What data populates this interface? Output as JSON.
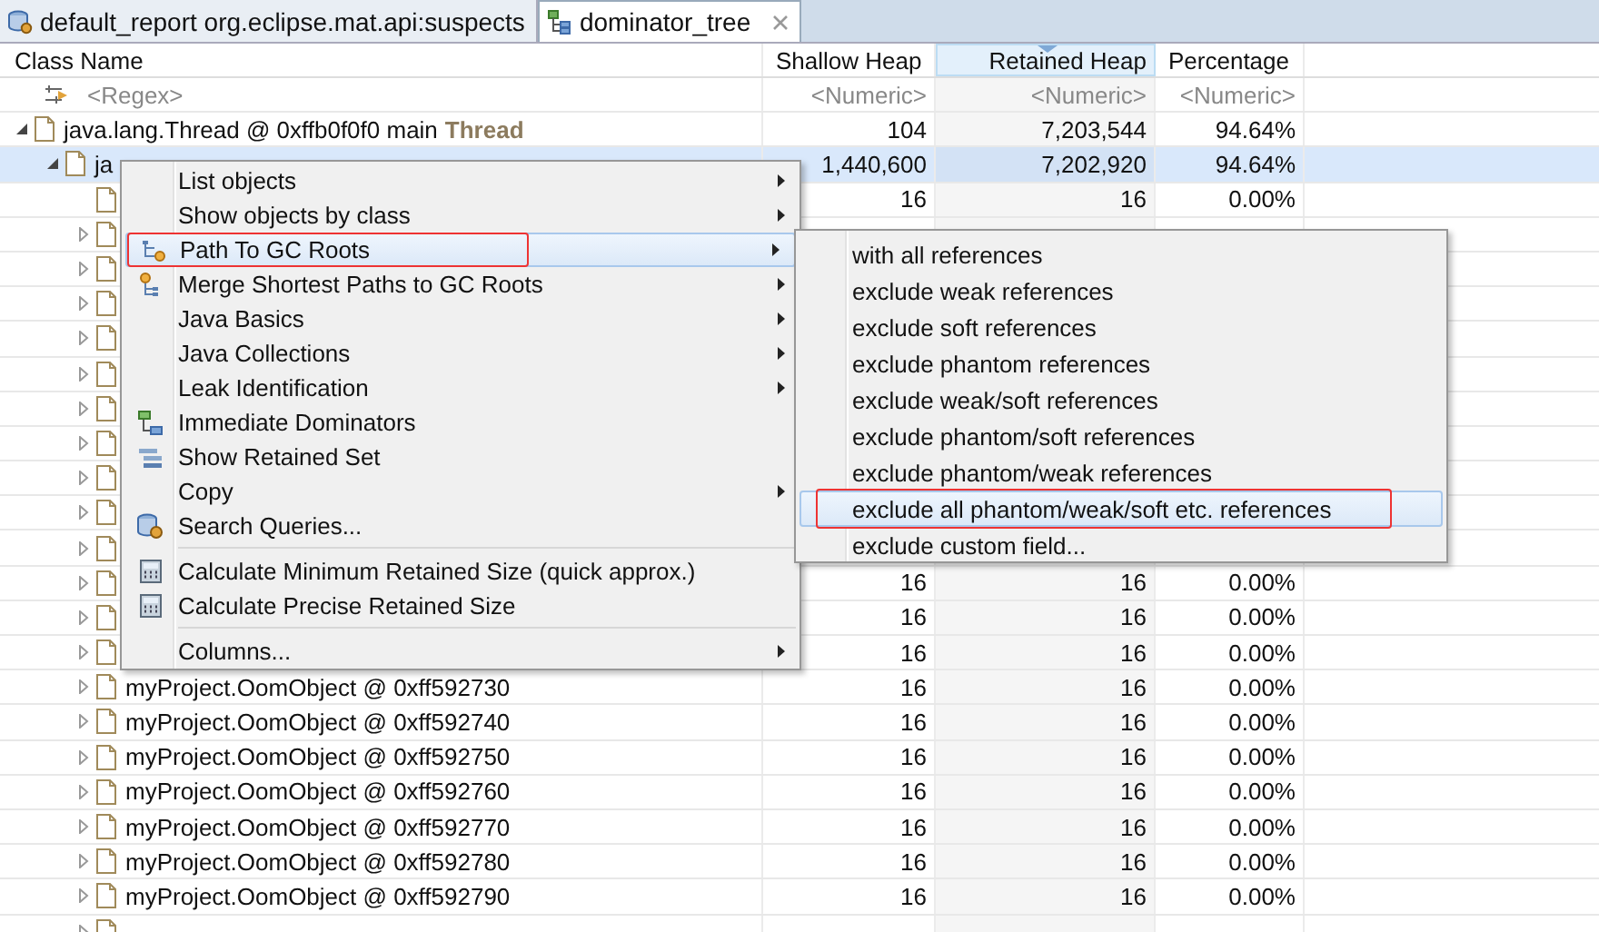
{
  "tabs": [
    {
      "label": "default_report  org.eclipse.mat.api:suspects",
      "selected": false,
      "closable": false
    },
    {
      "label": "dominator_tree",
      "selected": true,
      "closable": true
    }
  ],
  "columns": [
    {
      "label": "Class Name",
      "sorted": false
    },
    {
      "label": "Shallow Heap",
      "sorted": false
    },
    {
      "label": "Retained Heap",
      "sorted": true
    },
    {
      "label": "Percentage",
      "sorted": false
    }
  ],
  "filter_row": {
    "name": "<Regex>",
    "values": [
      "<Numeric>",
      "<Numeric>",
      "<Numeric>"
    ]
  },
  "tree": [
    {
      "name": "java.lang.Thread @ 0xffb0f0f0  main",
      "type_label": "Thread",
      "values": [
        "104",
        "7,203,544",
        "94.64%"
      ],
      "expanded": true,
      "selected": false,
      "children": [
        {
          "name": "ja",
          "values": [
            "1,440,600",
            "7,202,920",
            "94.64%"
          ],
          "expanded": true,
          "selected": true,
          "children": [
            {
              "leaf": true,
              "values": [
                "16",
                "16",
                "0.00%"
              ],
              "selected": false
            },
            {
              "expanded": false,
              "selected": false
            },
            {
              "expanded": false,
              "selected": false
            },
            {
              "expanded": false,
              "selected": false
            },
            {
              "expanded": false,
              "selected": false
            },
            {
              "expanded": false,
              "selected": false
            },
            {
              "expanded": false,
              "selected": false
            },
            {
              "expanded": false,
              "selected": false
            },
            {
              "expanded": false,
              "selected": false
            },
            {
              "expanded": false,
              "selected": false
            },
            {
              "expanded": false,
              "selected": false
            },
            {
              "expanded": false,
              "selected": false,
              "values": [
                "16",
                "16",
                "0.00%"
              ]
            },
            {
              "expanded": false,
              "selected": false,
              "values": [
                "16",
                "16",
                "0.00%"
              ]
            },
            {
              "expanded": false,
              "selected": false,
              "values": [
                "16",
                "16",
                "0.00%"
              ]
            },
            {
              "name": "myProject.OomObject @ 0xff592730",
              "expanded": false,
              "selected": false,
              "values": [
                "16",
                "16",
                "0.00%"
              ]
            },
            {
              "name": "myProject.OomObject @ 0xff592740",
              "expanded": false,
              "selected": false,
              "values": [
                "16",
                "16",
                "0.00%"
              ]
            },
            {
              "name": "myProject.OomObject @ 0xff592750",
              "expanded": false,
              "selected": false,
              "values": [
                "16",
                "16",
                "0.00%"
              ]
            },
            {
              "name": "myProject.OomObject @ 0xff592760",
              "expanded": false,
              "selected": false,
              "values": [
                "16",
                "16",
                "0.00%"
              ]
            },
            {
              "name": "myProject.OomObject @ 0xff592770",
              "expanded": false,
              "selected": false,
              "values": [
                "16",
                "16",
                "0.00%"
              ]
            },
            {
              "name": "myProject.OomObject @ 0xff592780",
              "expanded": false,
              "selected": false,
              "values": [
                "16",
                "16",
                "0.00%"
              ]
            },
            {
              "name": "myProject.OomObject @ 0xff592790",
              "expanded": false,
              "selected": false,
              "values": [
                "16",
                "16",
                "0.00%"
              ]
            },
            {
              "expanded": false,
              "selected": false
            }
          ]
        }
      ]
    }
  ],
  "context_menu": [
    {
      "kind": "plain",
      "label": "List objects",
      "submenu": true,
      "selected": false,
      "outlined": false
    },
    {
      "kind": "plain",
      "label": "Show objects by class",
      "submenu": true,
      "selected": false,
      "outlined": false
    },
    {
      "kind": "path",
      "label": "Path To GC Roots",
      "submenu": true,
      "selected": true,
      "outlined": true
    },
    {
      "kind": "merge",
      "label": "Merge Shortest Paths to GC Roots",
      "submenu": true,
      "selected": false,
      "outlined": false
    },
    {
      "kind": "plain",
      "label": "Java Basics",
      "submenu": true,
      "selected": false,
      "outlined": false
    },
    {
      "kind": "plain",
      "label": "Java Collections",
      "submenu": true,
      "selected": false,
      "outlined": false
    },
    {
      "kind": "plain",
      "label": "Leak Identification",
      "submenu": true,
      "selected": false,
      "outlined": false
    },
    {
      "kind": "dominators",
      "label": "Immediate Dominators",
      "submenu": false,
      "selected": false,
      "outlined": false
    },
    {
      "kind": "retained",
      "label": "Show Retained Set",
      "submenu": false,
      "selected": false,
      "outlined": false
    },
    {
      "kind": "plain",
      "label": "Copy",
      "submenu": true,
      "selected": false,
      "outlined": false
    },
    {
      "kind": "query",
      "label": "Search Queries...",
      "submenu": false,
      "selected": false,
      "outlined": false
    },
    {
      "kind": "separator"
    },
    {
      "kind": "calc",
      "label": "Calculate Minimum Retained Size (quick approx.)",
      "submenu": false,
      "selected": false,
      "outlined": false
    },
    {
      "kind": "calc",
      "label": "Calculate Precise Retained Size",
      "submenu": false,
      "selected": false,
      "outlined": false
    },
    {
      "kind": "separator"
    },
    {
      "kind": "plain",
      "label": "Columns...",
      "submenu": true,
      "selected": false,
      "outlined": false
    }
  ],
  "submenu": [
    {
      "label": "with all references",
      "selected": false,
      "outlined": false
    },
    {
      "label": "exclude weak references",
      "selected": false,
      "outlined": false
    },
    {
      "label": "exclude soft references",
      "selected": false,
      "outlined": false
    },
    {
      "label": "exclude phantom references",
      "selected": false,
      "outlined": false
    },
    {
      "label": "exclude weak/soft references",
      "selected": false,
      "outlined": false
    },
    {
      "label": "exclude phantom/soft references",
      "selected": false,
      "outlined": false
    },
    {
      "label": "exclude phantom/weak references",
      "selected": false,
      "outlined": false
    },
    {
      "label": "exclude all phantom/weak/soft etc. references",
      "selected": true,
      "outlined": true
    },
    {
      "label": "exclude custom field...",
      "selected": false,
      "outlined": false
    }
  ]
}
